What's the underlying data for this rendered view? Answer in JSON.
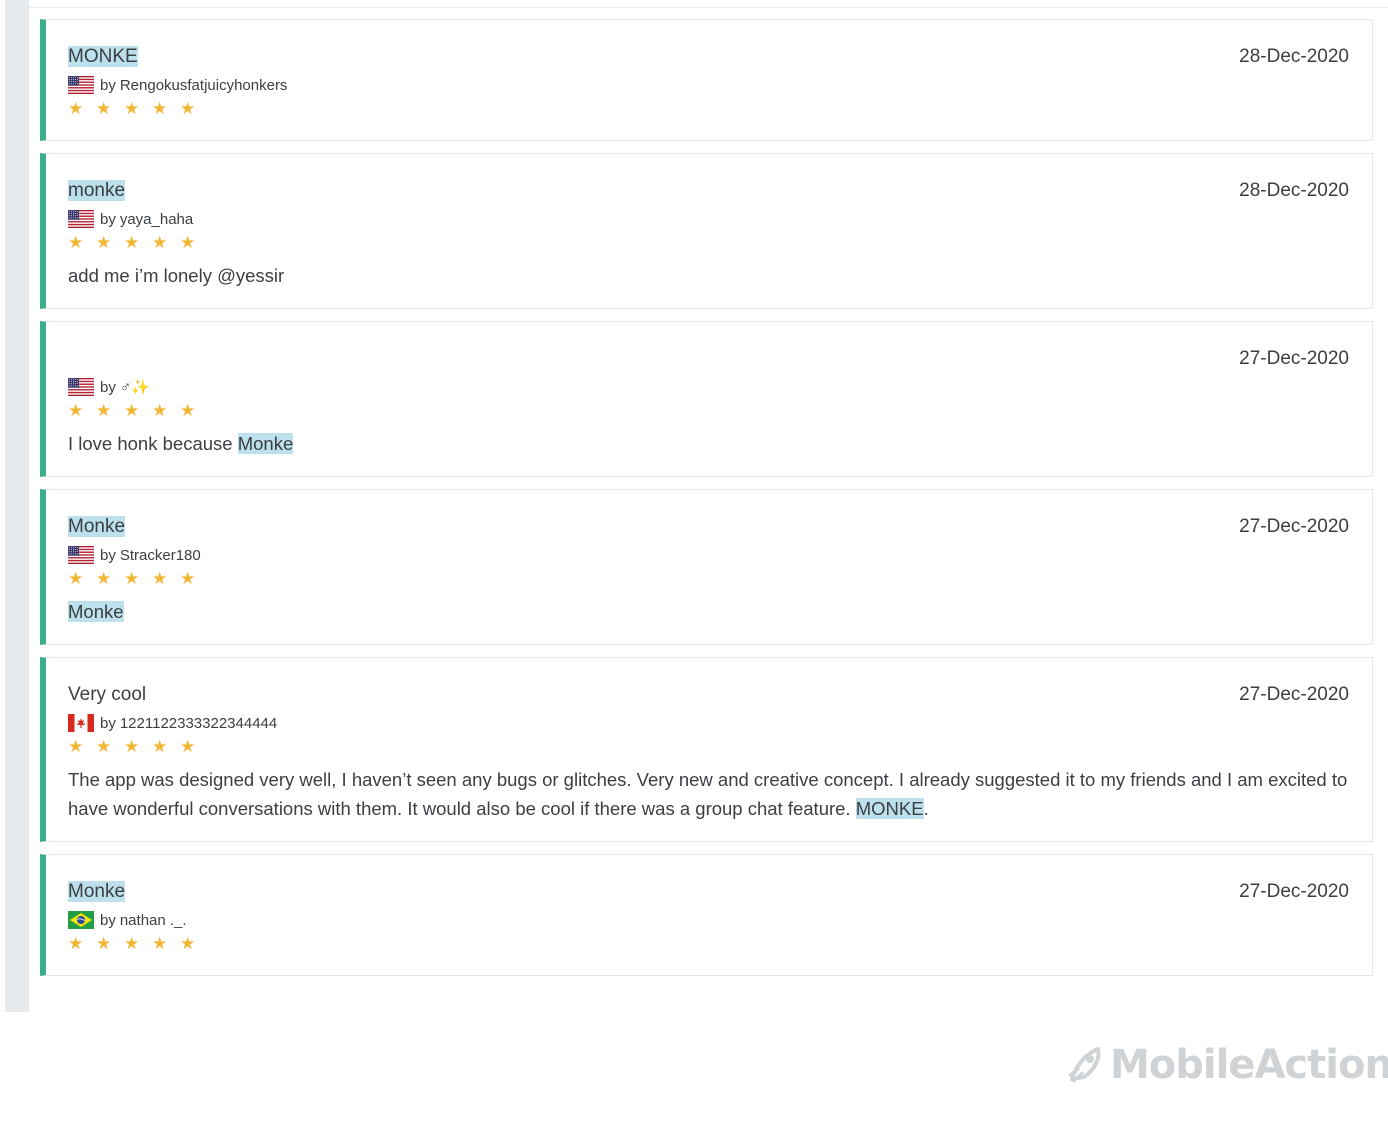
{
  "colors": {
    "accent": "#3bae8c",
    "star": "#f1b634",
    "highlight": "#bde1ec",
    "brand": "#cfd3d6"
  },
  "brand": {
    "name": "MobileAction"
  },
  "reviews": [
    {
      "title_segments": [
        {
          "text": "MONKE",
          "highlight": true
        }
      ],
      "date": "28-Dec-2020",
      "flag": "us-flag-icon",
      "by_label": "by",
      "author": "Rengokusfatjuicyhonkers",
      "rating": 5,
      "body_segments": []
    },
    {
      "title_segments": [
        {
          "text": "monke",
          "highlight": true
        }
      ],
      "date": "28-Dec-2020",
      "flag": "us-flag-icon",
      "by_label": "by",
      "author": "yaya_haha",
      "rating": 5,
      "body_segments": [
        {
          "text": "add me i’m lonely @yessir",
          "highlight": false
        }
      ]
    },
    {
      "title_segments": [],
      "date": "27-Dec-2020",
      "flag": "us-flag-icon",
      "by_label": "by",
      "author": "♂✨",
      "rating": 5,
      "body_segments": [
        {
          "text": "I love honk because ",
          "highlight": false
        },
        {
          "text": "Monke",
          "highlight": true
        }
      ]
    },
    {
      "title_segments": [
        {
          "text": "Monke",
          "highlight": true
        }
      ],
      "date": "27-Dec-2020",
      "flag": "us-flag-icon",
      "by_label": "by",
      "author": "Stracker180",
      "rating": 5,
      "body_segments": [
        {
          "text": "Monke",
          "highlight": true
        }
      ]
    },
    {
      "title_segments": [
        {
          "text": "Very cool",
          "highlight": false
        }
      ],
      "date": "27-Dec-2020",
      "flag": "canada-flag-icon",
      "by_label": "by",
      "author": "1221122333322344444",
      "rating": 5,
      "body_segments": [
        {
          "text": "The app was designed very well, I haven’t seen any bugs or glitches. Very new and creative concept. I already suggested it to my friends and I am excited to have wonderful conversations with them. It would also be cool if there was a group chat feature. ",
          "highlight": false
        },
        {
          "text": "MONKE",
          "highlight": true
        },
        {
          "text": ".",
          "highlight": false
        }
      ]
    },
    {
      "title_segments": [
        {
          "text": "Monke",
          "highlight": true
        }
      ],
      "date": "27-Dec-2020",
      "flag": "brazil-flag-icon",
      "by_label": "by",
      "author": "nathan ._.",
      "rating": 5,
      "body_segments": []
    }
  ]
}
